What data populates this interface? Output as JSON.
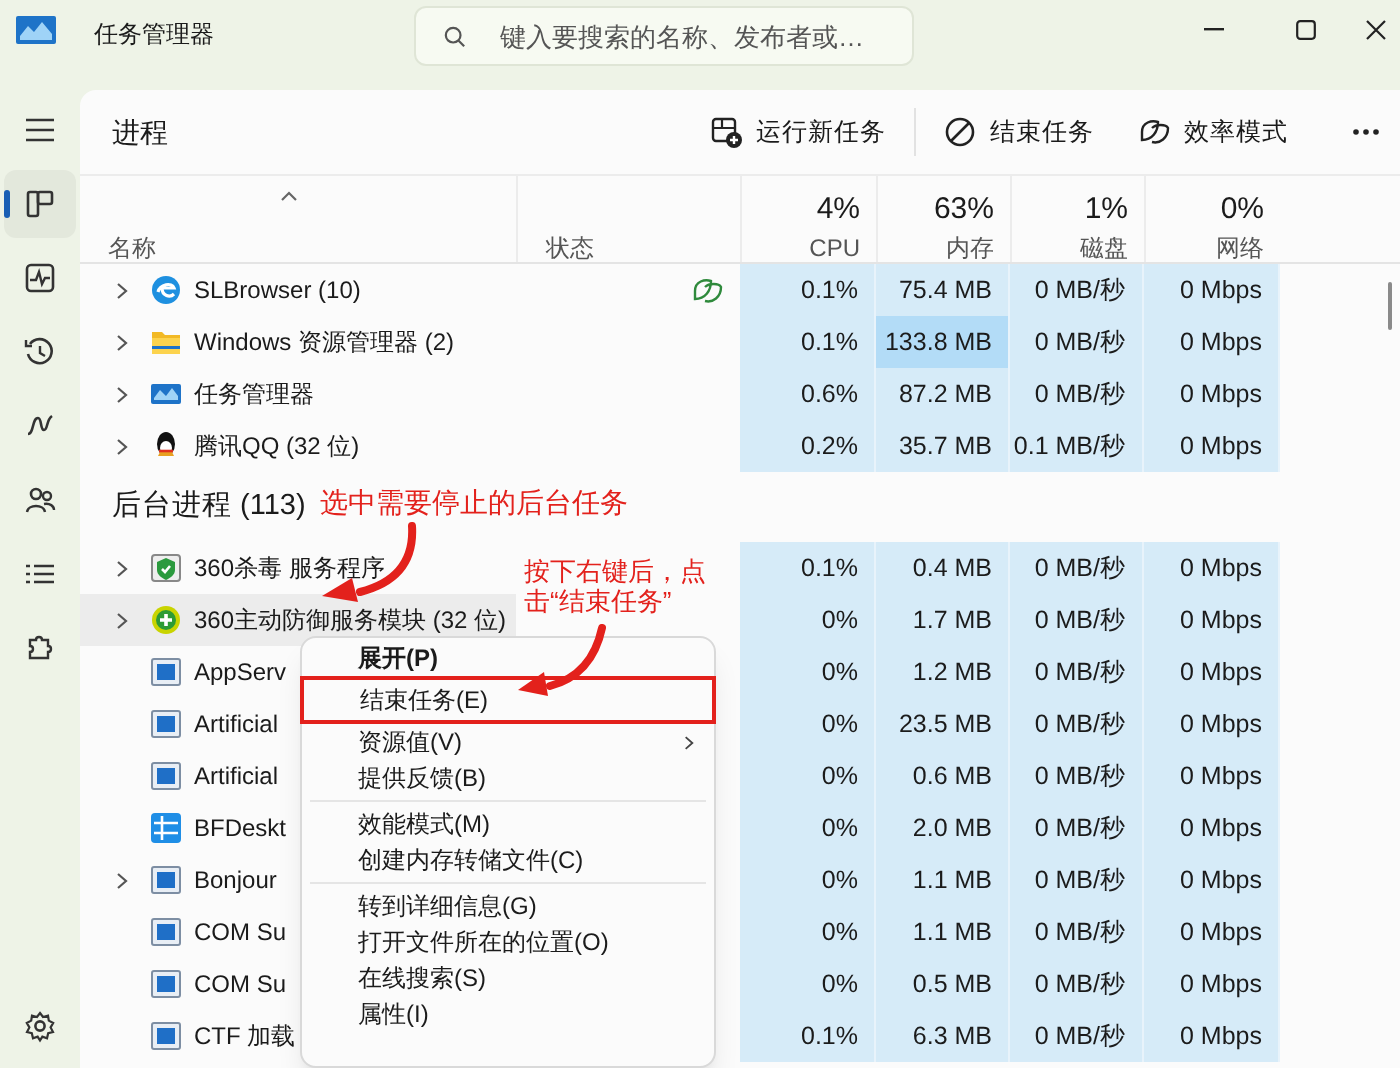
{
  "window": {
    "title": "任务管理器"
  },
  "search": {
    "placeholder": "键入要搜索的名称、发布者或…"
  },
  "sidebar": {
    "items": [
      {
        "selected": false
      },
      {
        "selected": true
      },
      {
        "selected": false
      },
      {
        "selected": false
      },
      {
        "selected": false
      },
      {
        "selected": false
      },
      {
        "selected": false
      },
      {
        "selected": false
      },
      {
        "selected": false
      }
    ]
  },
  "page": {
    "title": "进程"
  },
  "toolbar": [
    {
      "label": "运行新任务"
    },
    {
      "label": "结束任务"
    },
    {
      "label": "效率模式"
    }
  ],
  "table": {
    "columns": [
      {
        "label": "名称"
      },
      {
        "label": "状态"
      },
      {
        "usage": "4%",
        "label": "CPU"
      },
      {
        "usage": "63%",
        "label": "内存"
      },
      {
        "usage": "1%",
        "label": "磁盘"
      },
      {
        "usage": "0%",
        "label": "网络"
      }
    ],
    "rows": [
      {
        "kind": "process",
        "name": "SLBrowser (10)",
        "expandable": true,
        "selected": false,
        "efficiency": true,
        "cpu": "0.1%",
        "memory": "75.4 MB",
        "memory_high": false,
        "disk": "0 MB/秒",
        "network": "0 Mbps"
      },
      {
        "kind": "process",
        "name": "Windows 资源管理器 (2)",
        "expandable": true,
        "selected": false,
        "efficiency": false,
        "cpu": "0.1%",
        "memory": "133.8 MB",
        "memory_high": true,
        "disk": "0 MB/秒",
        "network": "0 Mbps"
      },
      {
        "kind": "process",
        "name": "任务管理器",
        "expandable": true,
        "selected": false,
        "efficiency": false,
        "cpu": "0.6%",
        "memory": "87.2 MB",
        "memory_high": false,
        "disk": "0 MB/秒",
        "network": "0 Mbps"
      },
      {
        "kind": "process",
        "name": "腾讯QQ (32 位)",
        "expandable": true,
        "selected": false,
        "efficiency": false,
        "cpu": "0.2%",
        "memory": "35.7 MB",
        "memory_high": false,
        "disk": "0.1 MB/秒",
        "network": "0 Mbps"
      },
      {
        "kind": "heading",
        "label": "后台进程 (113)"
      },
      {
        "kind": "process",
        "name": "360杀毒 服务程序",
        "expandable": true,
        "selected": false,
        "efficiency": false,
        "cpu": "0.1%",
        "memory": "0.4 MB",
        "memory_high": false,
        "disk": "0 MB/秒",
        "network": "0 Mbps"
      },
      {
        "kind": "process",
        "name": "360主动防御服务模块 (32 位)",
        "expandable": true,
        "selected": true,
        "efficiency": false,
        "cpu": "0%",
        "memory": "1.7 MB",
        "memory_high": false,
        "disk": "0 MB/秒",
        "network": "0 Mbps"
      },
      {
        "kind": "process",
        "name": "AppServ",
        "expandable": false,
        "selected": false,
        "efficiency": false,
        "cpu": "0%",
        "memory": "1.2 MB",
        "memory_high": false,
        "disk": "0 MB/秒",
        "network": "0 Mbps"
      },
      {
        "kind": "process",
        "name": "Artificial",
        "expandable": false,
        "selected": false,
        "efficiency": false,
        "cpu": "0%",
        "memory": "23.5 MB",
        "memory_high": false,
        "disk": "0 MB/秒",
        "network": "0 Mbps"
      },
      {
        "kind": "process",
        "name": "Artificial",
        "expandable": false,
        "selected": false,
        "efficiency": false,
        "cpu": "0%",
        "memory": "0.6 MB",
        "memory_high": false,
        "disk": "0 MB/秒",
        "network": "0 Mbps"
      },
      {
        "kind": "process",
        "name": "BFDeskt",
        "expandable": false,
        "selected": false,
        "efficiency": false,
        "cpu": "0%",
        "memory": "2.0 MB",
        "memory_high": false,
        "disk": "0 MB/秒",
        "network": "0 Mbps"
      },
      {
        "kind": "process",
        "name": "Bonjour",
        "expandable": true,
        "selected": false,
        "efficiency": false,
        "cpu": "0%",
        "memory": "1.1 MB",
        "memory_high": false,
        "disk": "0 MB/秒",
        "network": "0 Mbps"
      },
      {
        "kind": "process",
        "name": "COM Su",
        "expandable": false,
        "selected": false,
        "efficiency": false,
        "cpu": "0%",
        "memory": "1.1 MB",
        "memory_high": false,
        "disk": "0 MB/秒",
        "network": "0 Mbps"
      },
      {
        "kind": "process",
        "name": "COM Su",
        "expandable": false,
        "selected": false,
        "efficiency": false,
        "cpu": "0%",
        "memory": "0.5 MB",
        "memory_high": false,
        "disk": "0 MB/秒",
        "network": "0 Mbps"
      },
      {
        "kind": "process",
        "name": "CTF 加载",
        "expandable": false,
        "selected": false,
        "efficiency": false,
        "cpu": "0.1%",
        "memory": "6.3 MB",
        "memory_high": false,
        "disk": "0 MB/秒",
        "network": "0 Mbps"
      }
    ]
  },
  "context_menu": {
    "items": [
      {
        "kind": "default",
        "label": "展开(P)",
        "annotated": false
      },
      {
        "kind": "item",
        "label": "结束任务(E)",
        "annotated": true
      },
      {
        "kind": "submenu",
        "label": "资源值(V)",
        "annotated": false
      },
      {
        "kind": "item",
        "label": "提供反馈(B)",
        "annotated": false
      },
      {
        "kind": "separator"
      },
      {
        "kind": "item",
        "label": "效能模式(M)",
        "annotated": false
      },
      {
        "kind": "item",
        "label": "创建内存转储文件(C)",
        "annotated": false
      },
      {
        "kind": "separator"
      },
      {
        "kind": "item",
        "label": "转到详细信息(G)",
        "annotated": false
      },
      {
        "kind": "item",
        "label": "打开文件所在的位置(O)",
        "annotated": false
      },
      {
        "kind": "item",
        "label": "在线搜索(S)",
        "annotated": false
      },
      {
        "kind": "item",
        "label": "属性(I)",
        "annotated": false
      }
    ]
  },
  "annotations": [
    {
      "text": "选中需要停止的后台任务"
    },
    {
      "text": "按下右键后，点击“结束任务”"
    }
  ]
}
